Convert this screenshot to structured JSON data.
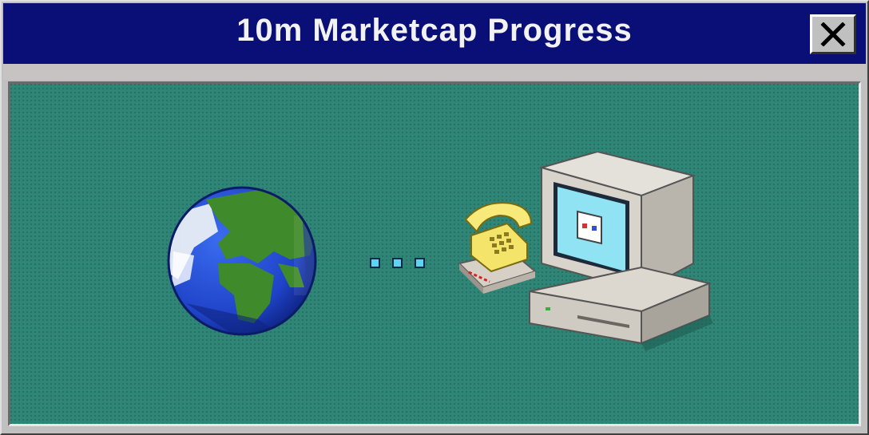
{
  "window": {
    "title": "10m Marketcap Progress"
  },
  "titlebar": {
    "close_icon": "close-x-icon"
  },
  "scene": {
    "left_icon": "globe-icon",
    "middle_icon": "transfer-dots-icon",
    "right_icon": "computer-with-phone-icon",
    "dots_count_visible": 3,
    "colors": {
      "titlebar": "#0a0f78",
      "panel": "#2f8677",
      "dots": "#5fd3f0"
    }
  }
}
